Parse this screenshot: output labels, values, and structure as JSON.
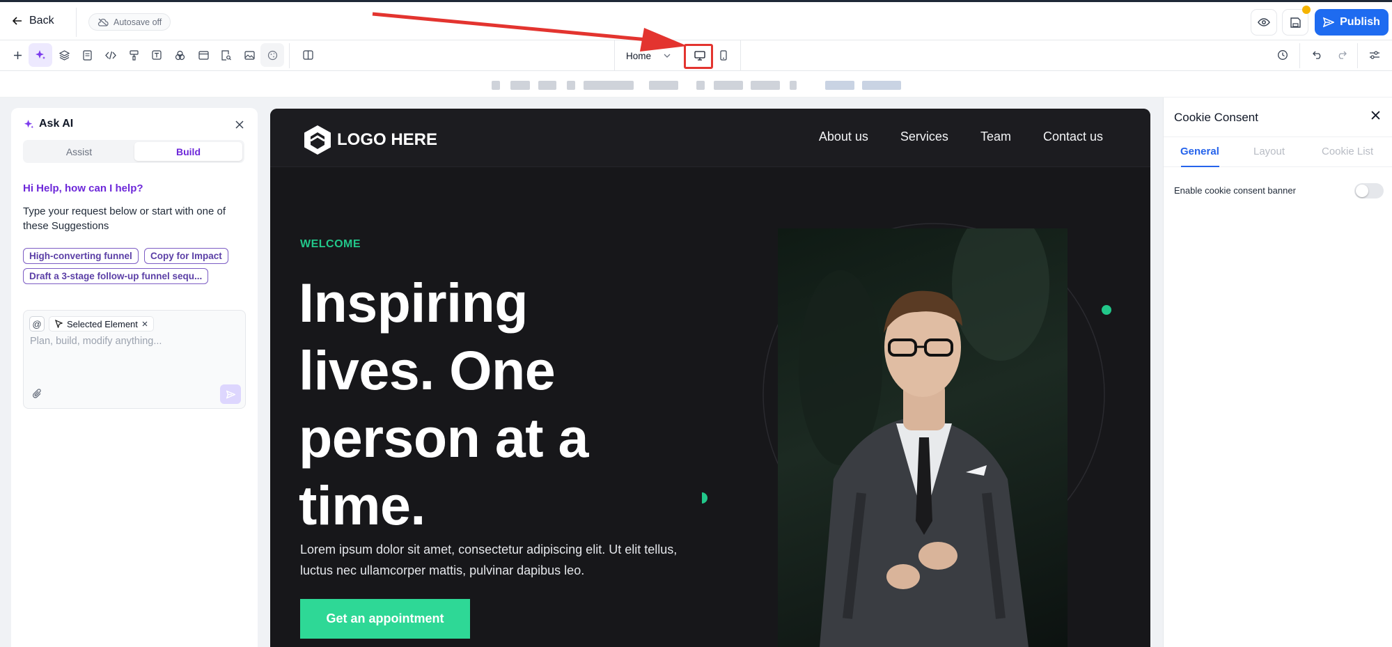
{
  "topbar": {
    "back_label": "Back",
    "autosave_label": "Autosave off",
    "publish_label": "Publish"
  },
  "toolbar": {
    "page_selector": "Home"
  },
  "ask_ai": {
    "title": "Ask AI",
    "tabs": [
      "Assist",
      "Build"
    ],
    "active_tab": "Build",
    "greeting": "Hi Help, how can I help?",
    "intro": "Type your request below or start with one of these Suggestions",
    "suggestions": [
      "High-converting funnel",
      "Copy for Impact",
      "Draft a 3-stage follow-up funnel sequ..."
    ],
    "at_symbol": "@",
    "selected_chip": "Selected Element",
    "input_placeholder": "Plan, build, modify anything..."
  },
  "site": {
    "logo_text": "LOGO HERE",
    "nav": [
      "About us",
      "Services",
      "Team",
      "Contact us"
    ],
    "eyebrow": "WELCOME",
    "headline": [
      "Inspiring",
      "lives. One",
      "person at a",
      "time."
    ],
    "body": "Lorem ipsum dolor sit amet, consectetur adipiscing elit. Ut elit tellus, luctus nec ullamcorper mattis, pulvinar dapibus leo.",
    "cta": "Get an appointment"
  },
  "cookie_panel": {
    "title": "Cookie Consent",
    "tabs": [
      "General",
      "Layout",
      "Cookie List"
    ],
    "active_tab": "General",
    "setting_label": "Enable cookie consent banner",
    "setting_enabled": false
  },
  "colors": {
    "publish": "#1e6bf0",
    "ai_accent": "#6d28d9",
    "site_bg": "#17171a",
    "site_accent": "#22c78a",
    "annotation_red": "#e3342f"
  }
}
